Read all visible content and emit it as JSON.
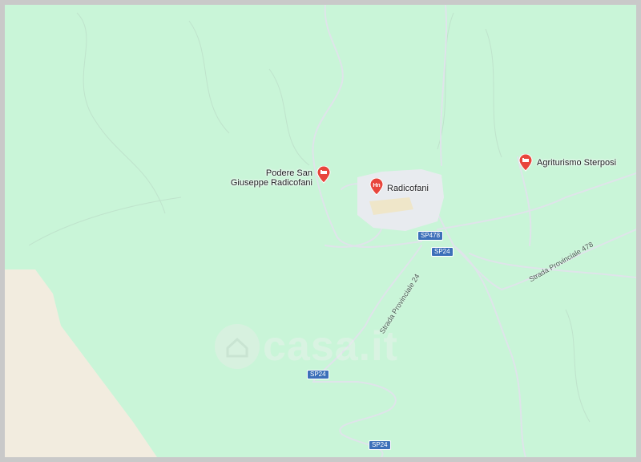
{
  "map": {
    "places": [
      {
        "name": "Agriturismo Sterposi",
        "type": "hotel"
      },
      {
        "name_line1": "Podere San",
        "name_line2": "Giuseppe Radicofani",
        "type": "hotel"
      },
      {
        "name": "Radicofani",
        "type": "town-hotel"
      }
    ],
    "road_shields": {
      "sp478": "SP478",
      "sp24_a": "SP24",
      "sp24_b": "SP24",
      "sp24_c": "SP24"
    },
    "road_labels": {
      "sp24_name": "Strada Provinciale 24",
      "sp478_name": "Strada Provinciale 478"
    },
    "watermark": "casa.it",
    "colors": {
      "land": "#c9f5d8",
      "road": "#dfe3e8",
      "pin": "#e8453c",
      "shield": "#3c6fb9"
    }
  }
}
